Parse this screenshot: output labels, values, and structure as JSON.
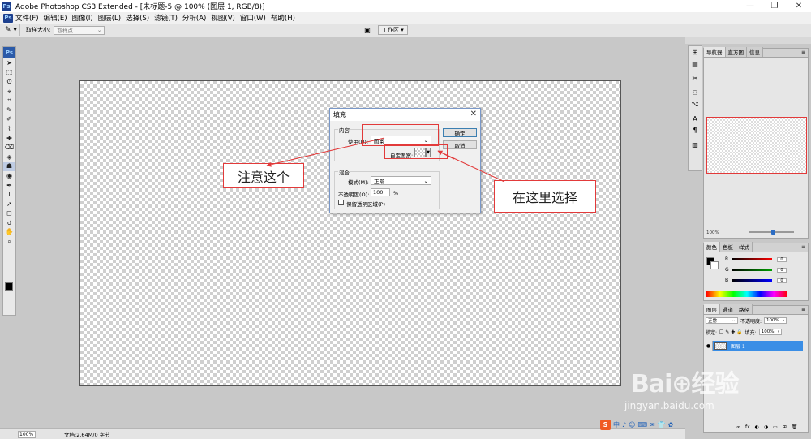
{
  "window": {
    "title": "Adobe Photoshop CS3 Extended - [未标题-5 @ 100% (图层 1, RGB/8)]",
    "app_icon": "Ps",
    "minimize": "—",
    "restore": "❐",
    "close": "✕"
  },
  "menu": [
    "文件(F)",
    "编辑(E)",
    "图像(I)",
    "图层(L)",
    "选择(S)",
    "滤镜(T)",
    "分析(A)",
    "视图(V)",
    "窗口(W)",
    "帮助(H)"
  ],
  "options_bar": {
    "tool_icon": "eyedropper-icon",
    "tool_glyph": "✎ ▾",
    "sample_size_label": "取样大小:",
    "sample_size_value": "取样点",
    "workspace_label": "工作区 ▾"
  },
  "toolbox": {
    "header": "Ps",
    "tools": [
      "➤",
      "⬚",
      "ʘ",
      "⌖",
      "⌗",
      "✎",
      "✐",
      "⌇",
      "✚",
      "⌫",
      "◈",
      "☗",
      "◉",
      "✒",
      "T",
      "➚",
      "◻",
      "☌",
      "✋",
      "⌕"
    ],
    "active_index": 11
  },
  "fill_dialog": {
    "title": "填充",
    "close": "✕",
    "content_group": "内容",
    "use_label": "使用(U):",
    "use_value": "图案",
    "custom_pattern_label": "自定图案:",
    "ok_label": "确定",
    "cancel_label": "取消",
    "blending_group": "混合",
    "mode_label": "模式(M):",
    "mode_value": "正常",
    "opacity_label": "不透明度(O):",
    "opacity_value": "100",
    "opacity_unit": "%",
    "preserve_transparency_label": "保留透明区域(P)"
  },
  "annotations": {
    "note_left": "注意这个",
    "note_right": "在这里选择",
    "accent_color": "#e23a3a"
  },
  "right_strip": [
    "⊞",
    "▤",
    "✂",
    "⚇",
    "⌥",
    "A",
    "¶",
    "▥"
  ],
  "navigator_panel": {
    "tabs": [
      "导航器",
      "直方图",
      "信息"
    ],
    "zoom": "100%"
  },
  "color_panel": {
    "tabs": [
      "颜色",
      "色板",
      "样式"
    ],
    "channels": [
      {
        "label": "R",
        "value": "0",
        "gradient": "linear-gradient(to right, #000, #ff0000)"
      },
      {
        "label": "G",
        "value": "0",
        "gradient": "linear-gradient(to right, #000, #00a000)"
      },
      {
        "label": "B",
        "value": "0",
        "gradient": "linear-gradient(to right, #000, #0000ff)"
      }
    ]
  },
  "layers_panel": {
    "tabs": [
      "图层",
      "通道",
      "路径"
    ],
    "blend_mode": "正常",
    "opacity_label": "不透明度:",
    "opacity_value": "100%",
    "lock_label": "锁定:",
    "fill_label": "填充:",
    "fill_value": "100%",
    "layer_name": "图层 1",
    "bottom_icons": [
      "∞",
      "fx",
      "◐",
      "◑",
      "▭",
      "⊞",
      "🗑"
    ]
  },
  "status_bar": {
    "zoom": "100%",
    "doc_info": "文档:2.64M/0 字节"
  },
  "watermark": {
    "brand": "Bai⊕经验",
    "url": "jingyan.baidu.com"
  },
  "ime": {
    "logo": "S",
    "items": [
      "中",
      "♪",
      "☺",
      "⌨",
      "✉",
      "👕",
      "✿"
    ]
  }
}
